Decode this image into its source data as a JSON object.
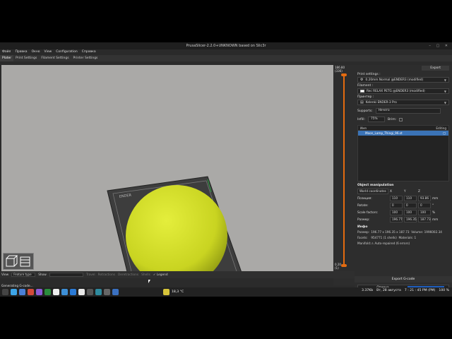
{
  "window": {
    "title": "PrusaSlicer-2.2.0+UNKNOWN based on Slic3r"
  },
  "menu": [
    "Файл",
    "Правка",
    "Окно",
    "View",
    "Configuration",
    "Справка"
  ],
  "tabs": [
    "Plater",
    "Print Settings",
    "Filament Settings",
    "Printer Settings"
  ],
  "slider": {
    "top": "186.80",
    "top2": "(336)",
    "bottom": "0.20",
    "bottom2": "(1)"
  },
  "right_panel": {
    "export_tab": "Export",
    "print_settings_label": "Print settings :",
    "print_settings_value": "0.20mm Normal @ENDER3 (modified)",
    "filament_label": "Filament :",
    "filament_value": "Rec RELAX PETG @ENDER3 (modified)",
    "printer_label": "Принтер :",
    "printer_value": "Kelenki ENDER-3 Pro",
    "supports_label": "Supports:",
    "supports_value": "Нечего",
    "infill_label": "Infill:",
    "infill_value": "75%",
    "brim_label": "Brim:",
    "list_header_name": "Имя",
    "list_header_edit": "Editing",
    "object_name": "Moon_Lamp_Thingi_96.st",
    "obj_manip_title": "Object manipulation",
    "coords_label": "World coordinates",
    "axis_x": "X",
    "axis_y": "Y",
    "axis_z": "Z",
    "position_label": "Позиция:",
    "position": [
      "110",
      "110",
      "93.86"
    ],
    "position_unit": "mm",
    "rotate_label": "Rotate:",
    "rotate": [
      "0",
      "0",
      "0"
    ],
    "rotate_unit": "°",
    "scale_label": "Scale factors:",
    "scale": [
      "100",
      "100",
      "100"
    ],
    "scale_unit": "%",
    "size_label": "Размер:",
    "size": [
      "196.77",
      "196.35",
      "187.73"
    ],
    "size_unit": "mm",
    "info_title": "Инфо",
    "info_size_k": "Размер:",
    "info_size_v": "196.77 x 196.35 x 187.73",
    "info_volume_k": "Volume:",
    "info_volume_v": "1996002.34",
    "info_facets_k": "Facets:",
    "info_facets_v": "954771 (1 shells)",
    "info_materials_k": "Materials:",
    "info_materials_v": "1",
    "info_manifold_k": "Manifold:",
    "info_manifold_v": "Auto-repaired (6 errors)",
    "export_gcode": "Export G-code",
    "progress_text": "Отмена"
  },
  "bottom_bar": {
    "view_label": "View",
    "view_value": "Feature type",
    "show_label": "Show",
    "toggles": [
      "Travel",
      "Retractions",
      "Deretractions",
      "Shells",
      "Legend"
    ]
  },
  "status": "Generating G-code...",
  "taskbar": {
    "weather": "18,3 °C",
    "net": "3.37Kb",
    "date": "Вт, 28 августа",
    "time": "7 : 21 : 45 PM (PM)",
    "battery": "100 %"
  },
  "colors": {
    "accent": "#3b73b6",
    "model": "#d6e12a",
    "bed": "#3d3d3d"
  }
}
